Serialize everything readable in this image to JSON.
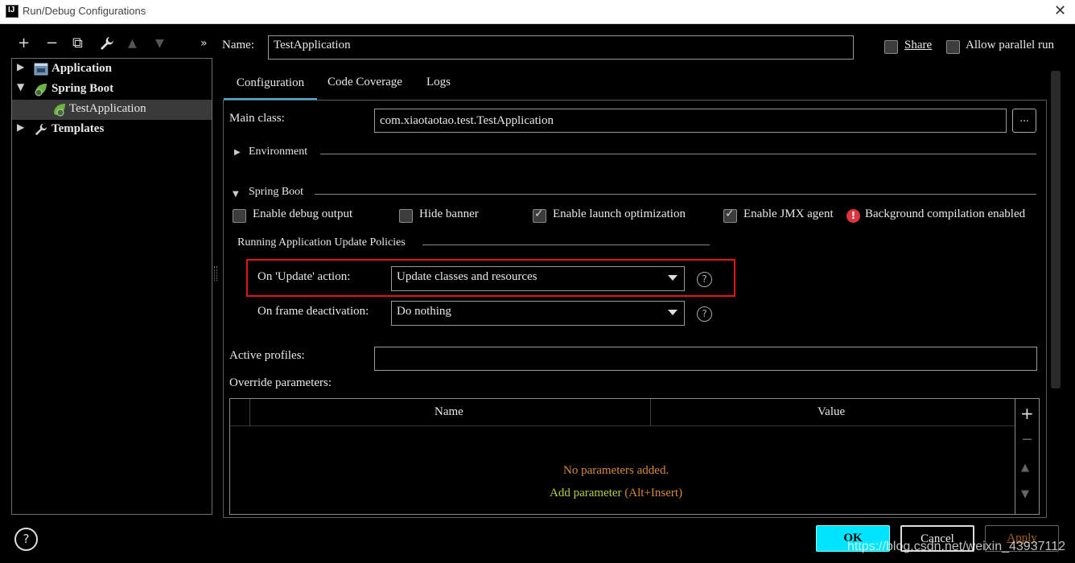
{
  "window": {
    "title": "Run/Debug Configurations"
  },
  "toolbar": {
    "add": "+",
    "remove": "−",
    "copy": "⧉",
    "edit": "🔧",
    "up": "▲",
    "down": "▼",
    "more": "»"
  },
  "tree": {
    "items": [
      {
        "label": "Application",
        "arrow": "▶"
      },
      {
        "label": "Spring Boot",
        "arrow": "▼"
      },
      {
        "label": "TestApplication"
      },
      {
        "label": "Templates",
        "arrow": "▶"
      }
    ]
  },
  "name_row": {
    "label": "Name:",
    "value": "TestApplication",
    "share_label": "Share",
    "share_checked": false,
    "parallel_label": "Allow parallel run",
    "parallel_checked": false
  },
  "tabs": [
    {
      "label": "Configuration",
      "active": true
    },
    {
      "label": "Code Coverage"
    },
    {
      "label": "Logs"
    }
  ],
  "config": {
    "main_class_label": "Main class:",
    "main_class_value": "com.xiaotaotao.test.TestApplication",
    "browse_label": "...",
    "environment_label": "Environment",
    "spring_boot_label": "Spring Boot",
    "enable_debug_output": {
      "label": "Enable debug output",
      "checked": false
    },
    "hide_banner": {
      "label": "Hide banner",
      "checked": false
    },
    "enable_launch_optimization": {
      "label": "Enable launch optimization",
      "checked": true
    },
    "enable_jmx_agent": {
      "label": "Enable JMX agent",
      "checked": true
    },
    "background_compilation": "Background compilation enabled",
    "policies_title": "Running Application Update Policies",
    "on_update_label": "On 'Update' action:",
    "on_update_value": "Update classes and resources",
    "on_frame_label": "On frame deactivation:",
    "on_frame_value": "Do nothing",
    "help_glyph": "?",
    "active_profiles_label": "Active profiles:",
    "active_profiles_value": "",
    "override_label": "Override parameters:"
  },
  "params_table": {
    "columns": [
      "Name",
      "Value"
    ],
    "empty_text": "No parameters added.",
    "add_link": "Add parameter",
    "add_shortcut": "(Alt+Insert)"
  },
  "footer": {
    "help": "?",
    "ok": "OK",
    "cancel": "Cancel",
    "apply": "Apply"
  },
  "watermark": "https://blog.csdn.net/weixin_43937112",
  "colors": {
    "accent": "#00e5ff",
    "highlight_box": "#e0161b",
    "warning_text": "#d7893a",
    "link_text": "#b6d13a",
    "error_icon": "#d9363e"
  }
}
